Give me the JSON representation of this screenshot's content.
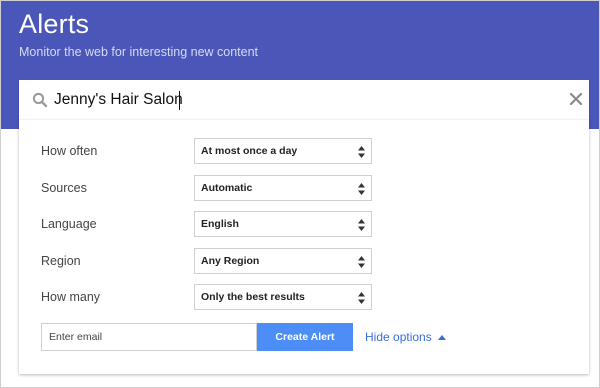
{
  "header": {
    "title": "Alerts",
    "subtitle": "Monitor the web for interesting new content",
    "background_color": "#4b56b9"
  },
  "search": {
    "icon": "search-icon",
    "value": "Jenny's Hair Salon",
    "clear_icon": "close-icon"
  },
  "options": {
    "rows": [
      {
        "label": "How often",
        "value": "At most once a day"
      },
      {
        "label": "Sources",
        "value": "Automatic"
      },
      {
        "label": "Language",
        "value": "English"
      },
      {
        "label": "Region",
        "value": "Any Region"
      },
      {
        "label": "How many",
        "value": "Only the best results"
      }
    ]
  },
  "footer": {
    "email_placeholder": "Enter email",
    "create_label": "Create Alert",
    "create_color": "#4d8ef6",
    "hide_options_label": "Hide options",
    "hide_options_icon": "caret-up-icon",
    "link_color": "#3a6fd8"
  }
}
